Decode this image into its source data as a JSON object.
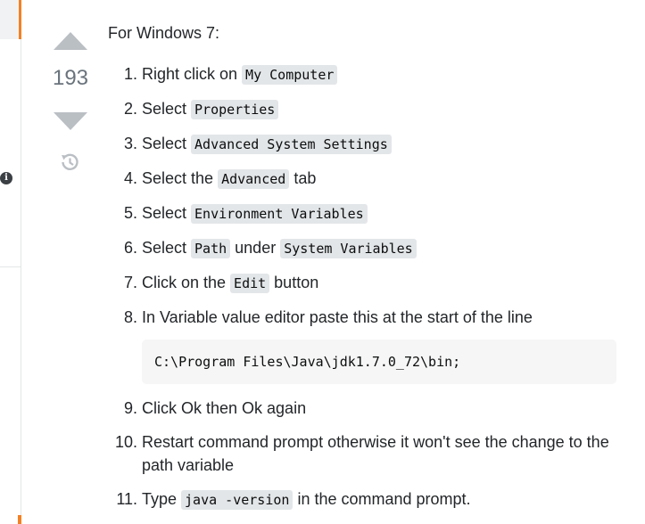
{
  "vote": {
    "count": "193"
  },
  "answer": {
    "intro": "For Windows 7:",
    "steps": [
      {
        "pre": "Right click on ",
        "code": "My Computer"
      },
      {
        "pre": "Select ",
        "code": "Properties"
      },
      {
        "pre": "Select ",
        "code": "Advanced System Settings"
      },
      {
        "pre": "Select the ",
        "code": "Advanced",
        "post": " tab"
      },
      {
        "pre": "Select ",
        "code": "Environment Variables"
      },
      {
        "pre": "Select ",
        "code": "Path",
        "mid": " under ",
        "code2": "System Variables"
      },
      {
        "pre": "Click on the ",
        "code": "Edit",
        "post": " button"
      },
      {
        "text": "In Variable value editor paste this at the start of the line",
        "codeblock": "C:\\Program Files\\Java\\jdk1.7.0_72\\bin;"
      },
      {
        "text": "Click Ok then Ok again"
      },
      {
        "text": "Restart command prompt otherwise it won't see the change to the path variable"
      },
      {
        "pre": "Type ",
        "code": "java -version",
        "post": " in the command prompt."
      }
    ]
  },
  "icons": {
    "upvote": "upvote-arrow-icon",
    "downvote": "downvote-arrow-icon",
    "history": "history-icon",
    "info": "info-icon"
  },
  "colors": {
    "accent": "#f48024",
    "vote_arrow": "#babfc4",
    "text": "#232629",
    "code_bg": "#e3e6e8",
    "codeblock_bg": "#f6f6f6"
  }
}
